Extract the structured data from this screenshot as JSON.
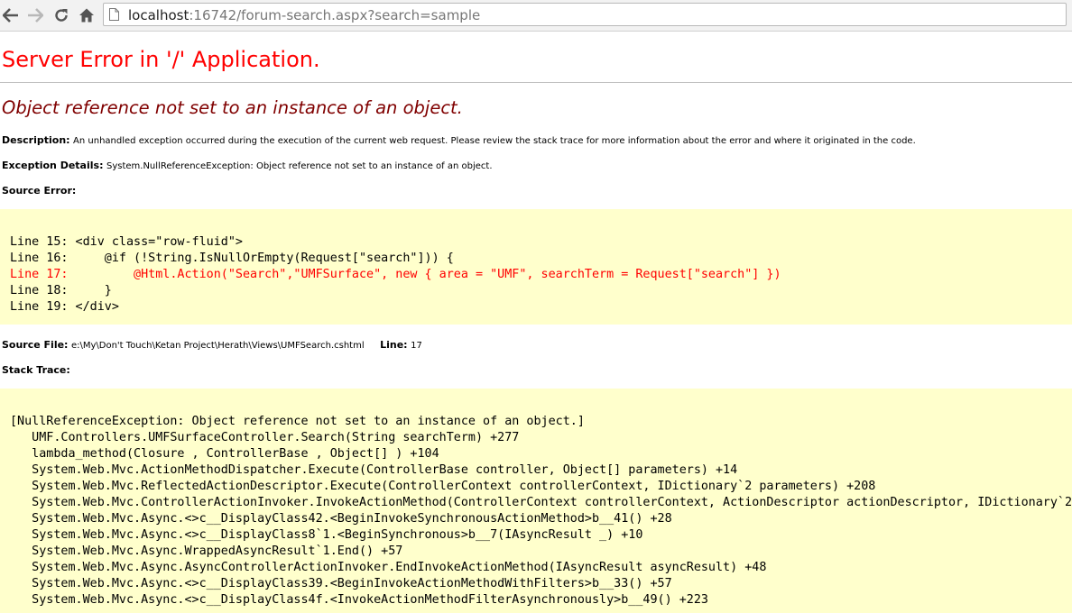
{
  "browser": {
    "url_host": "localhost",
    "url_rest": ":16742/forum-search.aspx?search=sample"
  },
  "error": {
    "title": "Server Error in '/' Application.",
    "message": "Object reference not set to an instance of an object.",
    "description_label": "Description:",
    "description_text": "An unhandled exception occurred during the execution of the current web request. Please review the stack trace for more information about the error and where it originated in the code.",
    "exception_label": "Exception Details:",
    "exception_text": "System.NullReferenceException: Object reference not set to an instance of an object.",
    "source_error_label": "Source Error:",
    "source_file_label": "Source File:",
    "source_file_path": "e:\\My\\Don't Touch\\Ketan Project\\Herath\\Views\\UMFSearch.cshtml",
    "line_label": "Line:",
    "line_number": "17",
    "stack_trace_label": "Stack Trace:"
  },
  "source_lines": [
    "Line 15: <div class=\"row-fluid\">",
    "Line 16:     @if (!String.IsNullOrEmpty(Request[\"search\"])) {",
    "Line 17:         @Html.Action(\"Search\",\"UMFSurface\", new { area = \"UMF\", searchTerm = Request[\"search\"] })",
    "Line 18:     }",
    "Line 19: </div>"
  ],
  "stack_trace": [
    "[NullReferenceException: Object reference not set to an instance of an object.]",
    "   UMF.Controllers.UMFSurfaceController.Search(String searchTerm) +277",
    "   lambda_method(Closure , ControllerBase , Object[] ) +104",
    "   System.Web.Mvc.ActionMethodDispatcher.Execute(ControllerBase controller, Object[] parameters) +14",
    "   System.Web.Mvc.ReflectedActionDescriptor.Execute(ControllerContext controllerContext, IDictionary`2 parameters) +208",
    "   System.Web.Mvc.ControllerActionInvoker.InvokeActionMethod(ControllerContext controllerContext, ActionDescriptor actionDescriptor, IDictionary`2",
    "   System.Web.Mvc.Async.<>c__DisplayClass42.<BeginInvokeSynchronousActionMethod>b__41() +28",
    "   System.Web.Mvc.Async.<>c__DisplayClass8`1.<BeginSynchronous>b__7(IAsyncResult _) +10",
    "   System.Web.Mvc.Async.WrappedAsyncResult`1.End() +57",
    "   System.Web.Mvc.Async.AsyncControllerActionInvoker.EndInvokeActionMethod(IAsyncResult asyncResult) +48",
    "   System.Web.Mvc.Async.<>c__DisplayClass39.<BeginInvokeActionMethodWithFilters>b__33() +57",
    "   System.Web.Mvc.Async.<>c__DisplayClass4f.<InvokeActionMethodFilterAsynchronously>b__49() +223"
  ]
}
